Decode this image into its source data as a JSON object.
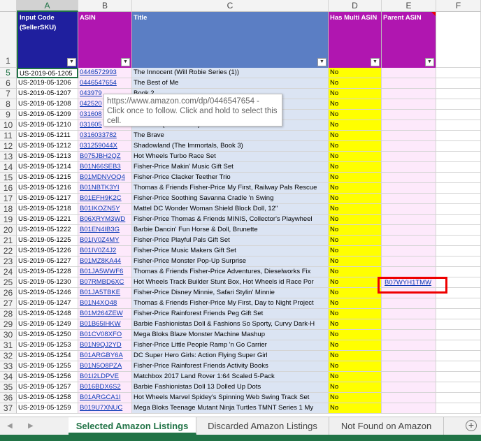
{
  "columns": [
    "A",
    "B",
    "C",
    "D",
    "E",
    "F"
  ],
  "headers": {
    "a": "Input Code (SellerSKU)",
    "b": "ASIN",
    "c": "Title",
    "d": "Has Multi ASIN",
    "e": "Parent ASIN",
    "header_row_number": "1"
  },
  "rows": [
    {
      "n": "5",
      "code": "US-2019-05-1205",
      "asin": "0446572993",
      "title": "The Innocent (Will Robie Series (1))",
      "multi": "No"
    },
    {
      "n": "6",
      "code": "US-2019-05-1206",
      "asin": "0446547654",
      "title": "The Best of Me",
      "multi": "No"
    },
    {
      "n": "7",
      "code": "US-2019-05-1207",
      "asin": "043979",
      "title": "                         Book 2",
      "multi": "No"
    },
    {
      "n": "8",
      "code": "US-2019-05-1208",
      "asin": "042520",
      "title": "",
      "multi": "No"
    },
    {
      "n": "9",
      "code": "US-2019-05-1209",
      "asin": "031608",
      "title": "",
      "multi": "No"
    },
    {
      "n": "10",
      "code": "US-2019-05-1210",
      "asin": "031605",
      "title": "Reckless (Mirrorworld)",
      "multi": "No"
    },
    {
      "n": "11",
      "code": "US-2019-05-1211",
      "asin": "0316033782",
      "title": "The Brave",
      "multi": "No"
    },
    {
      "n": "12",
      "code": "US-2019-05-1212",
      "asin": "031259044X",
      "title": "Shadowland (The Immortals, Book 3)",
      "multi": "No"
    },
    {
      "n": "13",
      "code": "US-2019-05-1213",
      "asin": "B075JBH2QZ",
      "title": "Hot Wheels Turbo Race Set",
      "multi": "No"
    },
    {
      "n": "14",
      "code": "US-2019-05-1214",
      "asin": "B01N66SEB3",
      "title": "Fisher-Price Makin' Music Gift Set",
      "multi": "No"
    },
    {
      "n": "15",
      "code": "US-2019-05-1215",
      "asin": "B01MDNVOQ4",
      "title": "Fisher-Price Clacker Teether Trio",
      "multi": "No"
    },
    {
      "n": "16",
      "code": "US-2019-05-1216",
      "asin": "B01NBTK3YI",
      "title": "Thomas & Friends Fisher-Price My First, Railway Pals Rescue",
      "multi": "No"
    },
    {
      "n": "17",
      "code": "US-2019-05-1217",
      "asin": "B01EFH9K2C",
      "title": "Fisher-Price Soothing Savanna Cradle 'n Swing",
      "multi": "No"
    },
    {
      "n": "18",
      "code": "US-2019-05-1218",
      "asin": "B01IKOZN5Y",
      "title": "Mattel DC Wonder Woman Shield Block Doll, 12\"",
      "multi": "No"
    },
    {
      "n": "19",
      "code": "US-2019-05-1221",
      "asin": "B06XRYM3WD",
      "title": "Fisher-Price Thomas & Friends MINIS, Collector's Playwheel",
      "multi": "No"
    },
    {
      "n": "20",
      "code": "US-2019-05-1222",
      "asin": "B01EN4IB3G",
      "title": "Barbie Dancin' Fun Horse & Doll, Brunette",
      "multi": "No"
    },
    {
      "n": "21",
      "code": "US-2019-05-1225",
      "asin": "B01IV0Z4MY",
      "title": "Fisher-Price Playful Pals Gift Set",
      "multi": "No"
    },
    {
      "n": "22",
      "code": "US-2019-05-1226",
      "asin": "B01IV0Z4J2",
      "title": "Fisher-Price Music Makers Gift Set",
      "multi": "No"
    },
    {
      "n": "23",
      "code": "US-2019-05-1227",
      "asin": "B01MZ8KA44",
      "title": "Fisher-Price Monster Pop-Up Surprise",
      "multi": "No"
    },
    {
      "n": "24",
      "code": "US-2019-05-1228",
      "asin": "B01JA5WWF6",
      "title": "Thomas & Friends Fisher-Price Adventures, Dieselworks Fix",
      "multi": "No"
    },
    {
      "n": "25",
      "code": "US-2019-05-1230",
      "asin": "B07RMBD6XC",
      "title": "Hot Wheels Track Builder Stunt Box, Hot Wheels id Race Por",
      "multi": "No",
      "parent": "B07WYH1TMW"
    },
    {
      "n": "26",
      "code": "US-2019-05-1246",
      "asin": "B01JA5TBKE",
      "title": "Fisher-Price Disney Minnie, Safari Stylin' Minnie",
      "multi": "No"
    },
    {
      "n": "27",
      "code": "US-2019-05-1247",
      "asin": "B01N4XO48",
      "title": "Thomas & Friends Fisher-Price My First, Day to Night Project",
      "multi": "No"
    },
    {
      "n": "28",
      "code": "US-2019-05-1248",
      "asin": "B01M264ZEW",
      "title": "Fisher-Price Rainforest Friends Peg Gift Set",
      "multi": "No"
    },
    {
      "n": "29",
      "code": "US-2019-05-1249",
      "asin": "B01B65IHKW",
      "title": "Barbie Fashionistas Doll & Fashions So Sporty, Curvy Dark-H",
      "multi": "No"
    },
    {
      "n": "30",
      "code": "US-2019-05-1250",
      "asin": "B01CV08XFO",
      "title": "Mega Bloks Blaze Monster Machine Mashup",
      "multi": "No"
    },
    {
      "n": "31",
      "code": "US-2019-05-1253",
      "asin": "B01N9QJ2YD",
      "title": "Fisher-Price Little People Ramp 'n Go Carrier",
      "multi": "No"
    },
    {
      "n": "32",
      "code": "US-2019-05-1254",
      "asin": "B01ARGBY6A",
      "title": "DC Super Hero Girls: Action Flying Super Girl",
      "multi": "No"
    },
    {
      "n": "33",
      "code": "US-2019-05-1255",
      "asin": "B01N5O8PZA",
      "title": "Fisher-Price Rainforest Friends Activity Books",
      "multi": "No"
    },
    {
      "n": "34",
      "code": "US-2019-05-1256",
      "asin": "B01I2LDPVE",
      "title": "Matchbox 2017 Land Rover 1:64 Scaled 5-Pack",
      "multi": "No"
    },
    {
      "n": "35",
      "code": "US-2019-05-1257",
      "asin": "B016BDX6S2",
      "title": "Barbie Fashionistas Doll 13 Dolled Up Dots",
      "multi": "No"
    },
    {
      "n": "36",
      "code": "US-2019-05-1258",
      "asin": "B01ARGCA1I",
      "title": "Hot Wheels Marvel Spidey's Spinning Web Swing Track Set",
      "multi": "No"
    },
    {
      "n": "37",
      "code": "US-2019-05-1259",
      "asin": "B019U7XNUC",
      "title": "Mega Bloks Teenage Mutant Ninja Turtles TMNT Series 1 My",
      "multi": "No"
    }
  ],
  "tooltip": "https://www.amazon.com/dp/0446547654 - Click once to follow. Click and hold to select this cell.",
  "tabs": {
    "t1": "Selected Amazon Listings",
    "t2": "Discarded Amazon Listings",
    "t3": "Not Found on Amazon",
    "prev": "◀",
    "next": "▶",
    "add": "+"
  },
  "colors": {
    "header_a": "#1f1f9e",
    "header_b": "#b016b0",
    "header_c": "#5b7ec4",
    "header_d": "#b016b0",
    "header_e": "#b016b0",
    "col_a_bg": "#ffffff",
    "col_b_bg": "#fde9fb",
    "col_c_bg": "#dbe4f3",
    "col_d_bg": "#ffff00",
    "col_e_bg": "#fde9fb",
    "highlight": "#ee0000",
    "excel_green": "#217346"
  }
}
